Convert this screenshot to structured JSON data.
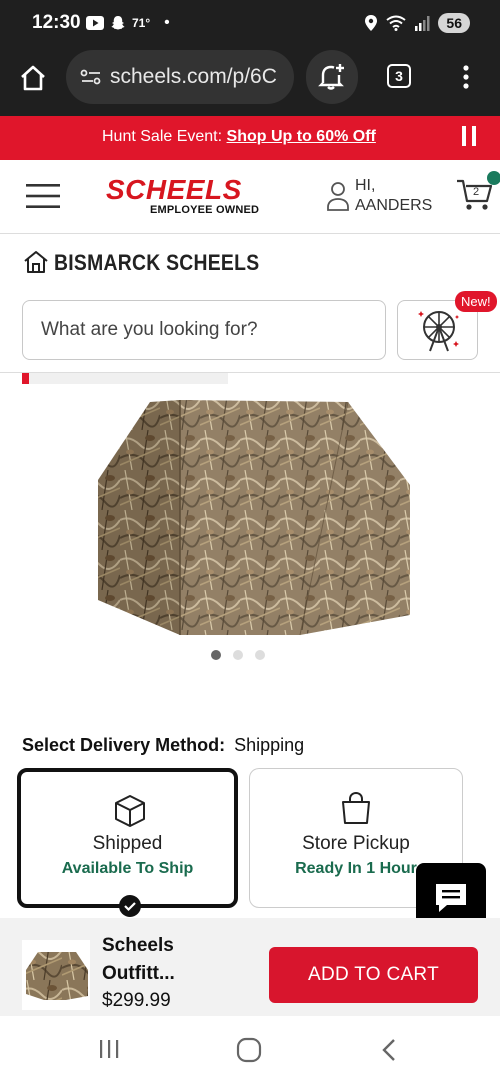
{
  "status_bar": {
    "time": "12:30",
    "temp": "71°",
    "battery": "56"
  },
  "browser": {
    "url": "scheels.com/p/6C",
    "tab_count": "3"
  },
  "promo": {
    "prefix": "Hunt Sale Event:",
    "link": "Shop Up to 60% Off"
  },
  "header": {
    "logo": "SCHEELS",
    "logo_sub": "EMPLOYEE OWNED",
    "greeting_line1": "HI,",
    "greeting_line2": "AANDERS",
    "cart_count": "2"
  },
  "store": {
    "name": "BISMARCK SCHEELS"
  },
  "search": {
    "placeholder": "What are you looking for?"
  },
  "new_badge": "New!",
  "carousel": {
    "total_images": 3,
    "active_index": 0
  },
  "delivery": {
    "label": "Select Delivery Method:",
    "selected": "Shipping",
    "options": [
      {
        "title": "Shipped",
        "status": "Available To Ship"
      },
      {
        "title": "Store Pickup",
        "status": "Ready In 1 Hour"
      }
    ]
  },
  "product": {
    "name_line1": "Scheels",
    "name_line2": "Outfitt...",
    "price": "$299.99"
  },
  "cta": {
    "add_to_cart": "ADD TO CART"
  },
  "colors": {
    "brand_red": "#e0162b",
    "green": "#1a6b4e",
    "dark": "#1f1f1f"
  }
}
